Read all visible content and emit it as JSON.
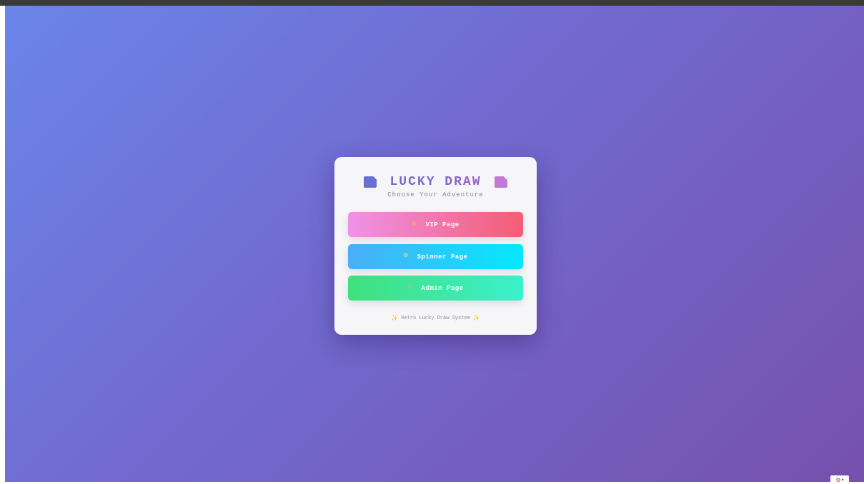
{
  "card": {
    "title": "LUCKY DRAW",
    "subtitle": "Choose Your Adventure",
    "buttons": [
      {
        "label": "VIP Page",
        "icon": "crown-icon",
        "glyph": "♛"
      },
      {
        "label": "Spinner Page",
        "icon": "wheel-icon",
        "glyph": "☸"
      },
      {
        "label": "Admin Page",
        "icon": "gear-icon",
        "glyph": "⚙"
      }
    ],
    "footer": "Retro Lucky Draw System",
    "footer_glyph": "✨"
  },
  "corner_widget": {
    "icon": "settings-icon",
    "glyph": "⚙",
    "caret": "▾"
  },
  "colors": {
    "bg_start": "#6a85e8",
    "bg_end": "#7651ad",
    "vip_start": "#ef92e8",
    "vip_end": "#f45d74",
    "spinner_start": "#4aaef8",
    "spinner_end": "#05e8fe",
    "admin_start": "#3fe07c",
    "admin_end": "#3bf0cc"
  }
}
